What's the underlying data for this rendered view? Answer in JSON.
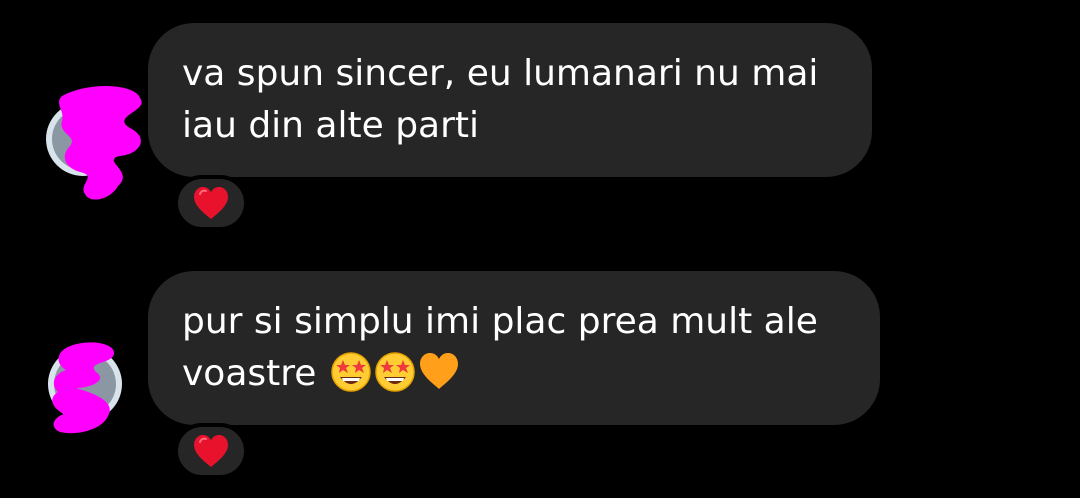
{
  "colors": {
    "background": "#000000",
    "bubble": "#262626",
    "text": "#ffffff",
    "heart": "#e8122d",
    "redaction": "#ff00ff"
  },
  "messages": [
    {
      "lines": [
        "va spun sincer, eu lumanari nu mai",
        "iau din alte parti"
      ],
      "reaction": "red-heart-icon"
    },
    {
      "lines": [
        "pur si simplu imi plac prea mult ale",
        "voastre"
      ],
      "emojis": [
        "star-struck-emoji-icon",
        "star-struck-emoji-icon",
        "orange-heart-icon"
      ],
      "reaction": "red-heart-icon"
    }
  ]
}
